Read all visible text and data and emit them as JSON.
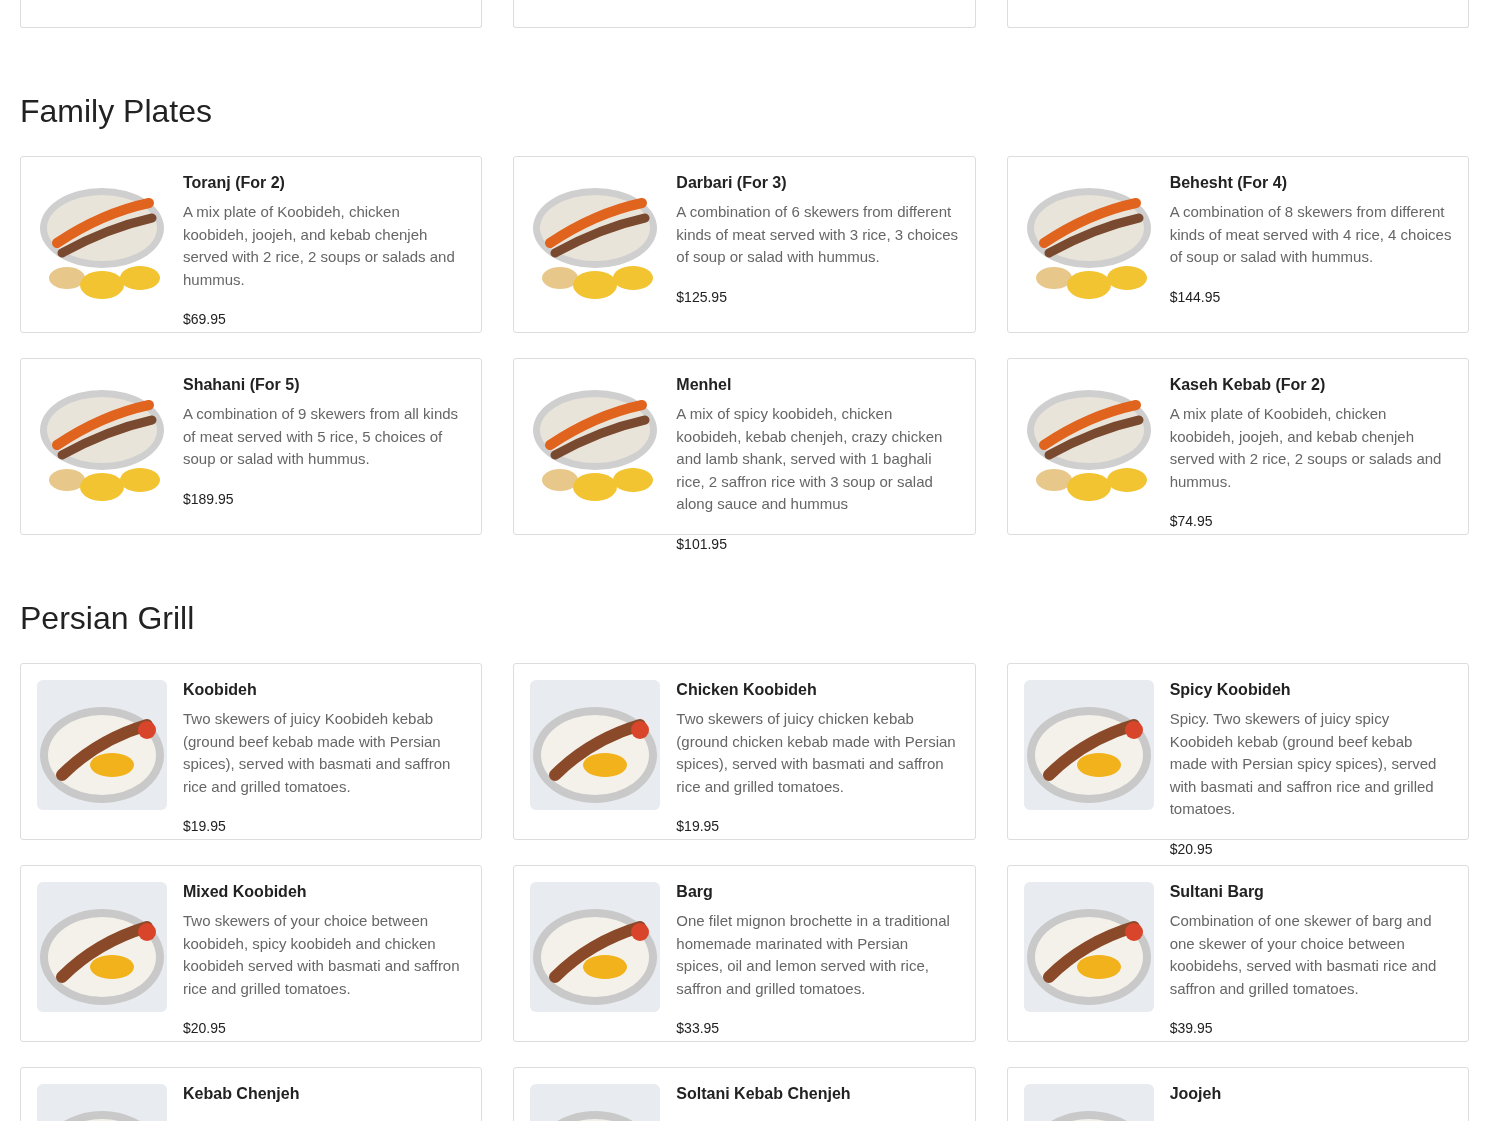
{
  "sections": [
    {
      "title": "Family Plates",
      "items": [
        {
          "name": "Toranj (For 2)",
          "description": "A mix plate of Koobideh, chicken koobideh, joojeh, and kebab chenjeh served with 2 rice, 2 soups or salads and hummus.",
          "price": "$69.95",
          "kind": "platter"
        },
        {
          "name": "Darbari (For 3)",
          "description": "A combination of 6 skewers from different kinds of meat served with 3 rice, 3 choices of soup or salad with hummus.",
          "price": "$125.95",
          "kind": "platter"
        },
        {
          "name": "Behesht (For 4)",
          "description": "A combination of 8 skewers from different kinds of meat served with 4 rice, 4 choices of soup or salad with hummus.",
          "price": "$144.95",
          "kind": "platter"
        },
        {
          "name": "Shahani (For 5)",
          "description": "A combination of 9 skewers from all kinds of meat served with 5 rice, 5 choices of soup or salad with hummus.",
          "price": "$189.95",
          "kind": "platter"
        },
        {
          "name": "Menhel",
          "description": "A mix of spicy koobideh, chicken koobideh, kebab chenjeh, crazy chicken and lamb shank, served with 1 baghali rice, 2 saffron rice with 3 soup or salad along sauce and hummus",
          "price": "$101.95",
          "kind": "platter"
        },
        {
          "name": "Kaseh Kebab (For 2)",
          "description": "A mix plate of Koobideh, chicken koobideh, joojeh, and kebab chenjeh served with 2 rice, 2 soups or salads and hummus.",
          "price": "$74.95",
          "kind": "platter"
        }
      ]
    },
    {
      "title": "Persian Grill",
      "items": [
        {
          "name": "Koobideh",
          "description": "Two skewers of juicy Koobideh kebab (ground beef kebab made with Persian spices), served with basmati and saffron rice and grilled tomatoes.",
          "price": "$19.95",
          "kind": "plate"
        },
        {
          "name": "Chicken Koobideh",
          "description": "Two skewers of juicy chicken kebab (ground chicken kebab made with Persian spices), served with basmati and saffron rice and grilled tomatoes.",
          "price": "$19.95",
          "kind": "plate"
        },
        {
          "name": "Spicy Koobideh",
          "description": "Spicy. Two skewers of juicy spicy Koobideh kebab (ground beef kebab made with Persian spicy spices), served with basmati and saffron rice and grilled tomatoes.",
          "price": "$20.95",
          "kind": "plate"
        },
        {
          "name": "Mixed Koobideh",
          "description": "Two skewers of your choice between koobideh, spicy koobideh and chicken koobideh served with basmati and saffron rice and grilled tomatoes.",
          "price": "$20.95",
          "kind": "plate"
        },
        {
          "name": "Barg",
          "description": "One filet mignon brochette in a traditional homemade marinated with Persian spices, oil and lemon served with rice, saffron and grilled tomatoes.",
          "price": "$33.95",
          "kind": "plate"
        },
        {
          "name": "Sultani Barg",
          "description": "Combination of one skewer of barg and one skewer of your choice between koobidehs, served with basmati rice and saffron and grilled tomatoes.",
          "price": "$39.95",
          "kind": "plate"
        },
        {
          "name": "Kebab Chenjeh",
          "kind": "plate"
        },
        {
          "name": "Soltani Kebab Chenjeh",
          "kind": "plate"
        },
        {
          "name": "Joojeh",
          "kind": "plate"
        }
      ]
    }
  ]
}
